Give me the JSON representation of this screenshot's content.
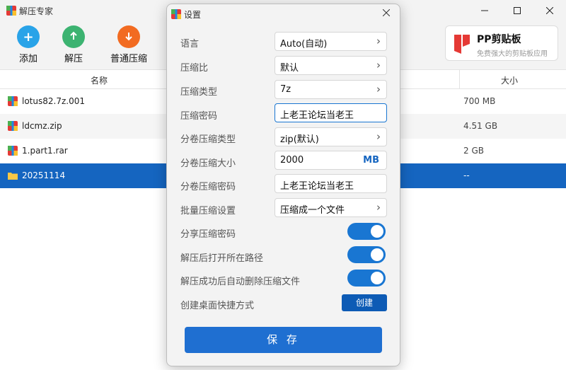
{
  "window": {
    "title": "解压专家",
    "controls": [
      "minimize-icon",
      "maximize-icon",
      "close-icon"
    ]
  },
  "toolbar": {
    "add_label": "添加",
    "extract_label": "解压",
    "compress_label": "普通压缩"
  },
  "promo": {
    "title": "PP剪贴板",
    "subtitle": "免费强大的剪贴板应用"
  },
  "table": {
    "columns": {
      "name": "名称",
      "size": "大小"
    },
    "rows": [
      {
        "name": "lotus82.7z.001",
        "size": "700 MB",
        "icon": "archive-icon"
      },
      {
        "name": "ldcmz.zip",
        "size": "4.51 GB",
        "icon": "archive-icon"
      },
      {
        "name": "1.part1.rar",
        "size": "2 GB",
        "icon": "archive-icon"
      },
      {
        "name": "20251114",
        "size": "--",
        "icon": "folder-icon"
      }
    ]
  },
  "dialog": {
    "title": "设置",
    "fields": {
      "language": {
        "label": "语言",
        "value": "Auto(自动)"
      },
      "ratio": {
        "label": "压缩比",
        "value": "默认"
      },
      "type": {
        "label": "压缩类型",
        "value": "7z"
      },
      "password": {
        "label": "压缩密码",
        "value": "上老王论坛当老王"
      },
      "split_type": {
        "label": "分卷压缩类型",
        "value": "zip(默认)"
      },
      "split_size": {
        "label": "分卷压缩大小",
        "value": "2000",
        "unit": "MB"
      },
      "split_password": {
        "label": "分卷压缩密码",
        "value": "上老王论坛当老王"
      },
      "batch": {
        "label": "批量压缩设置",
        "value": "压缩成一个文件"
      }
    },
    "toggles": {
      "share_password": {
        "label": "分享压缩密码",
        "on": true
      },
      "open_after": {
        "label": "解压后打开所在路径",
        "on": true
      },
      "delete_after": {
        "label": "解压成功后自动删除压缩文件",
        "on": true
      }
    },
    "shortcut": {
      "label": "创建桌面快捷方式",
      "button": "创建"
    },
    "save_label": "保 存"
  },
  "colors": {
    "accent": "#1976d2",
    "selection": "#1565c0",
    "add_icon": "#29a3e8",
    "extract_icon": "#3cb371",
    "compress_icon": "#f26b21",
    "promo_logo": "#e53935"
  }
}
